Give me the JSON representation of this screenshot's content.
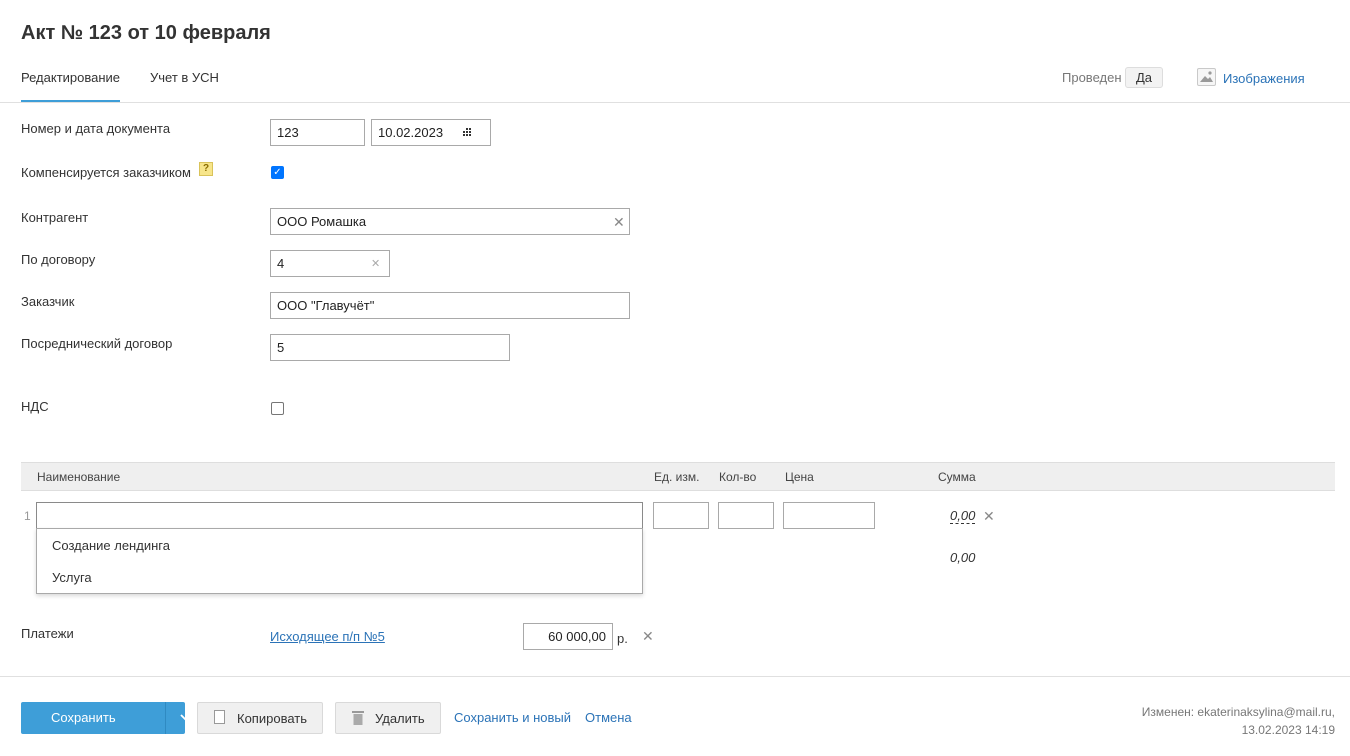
{
  "page_title": "Акт № 123 от 10 февраля",
  "tabs": [
    {
      "label": "Редактирование",
      "active": true
    },
    {
      "label": "Учет в УСН",
      "active": false
    }
  ],
  "status": {
    "posted_label": "Проведен",
    "posted_value": "Да"
  },
  "images_link": "Изображения",
  "form": {
    "doc_label": "Номер и дата документа",
    "doc_number": "123",
    "doc_date": "10.02.2023",
    "compensated_label": "Компенсируется заказчиком",
    "compensated_checked": true,
    "help_icon": "?",
    "contractor_label": "Контрагент",
    "contractor_value": "ООО Ромашка",
    "contract_label": "По договору",
    "contract_value": "4",
    "customer_label": "Заказчик",
    "customer_value": "ООО \"Главучёт\"",
    "agency_label": "Посреднический договор",
    "agency_value": "5",
    "vat_label": "НДС",
    "vat_checked": false
  },
  "table": {
    "headers": {
      "name": "Наименование",
      "unit": "Ед. изм.",
      "qty": "Кол-во",
      "price": "Цена",
      "sum": "Сумма"
    },
    "rows": [
      {
        "num": "1",
        "name": "",
        "unit": "",
        "qty": "",
        "price": "",
        "sum": "0,00"
      }
    ],
    "total": "0,00",
    "suggestions": [
      "Создание лендинга",
      "Услуга"
    ]
  },
  "payments": {
    "label": "Платежи",
    "link": "Исходящее п/п №5",
    "amount": "60 000,00",
    "currency": "р."
  },
  "footer": {
    "save": "Сохранить",
    "copy": "Копировать",
    "delete": "Удалить",
    "save_new": "Сохранить и новый",
    "cancel": "Отмена",
    "modified_line1": "Изменен: ekaterinaksylina@mail.ru,",
    "modified_line2": "13.02.2023 14:19"
  },
  "icons": {
    "clear": "✕",
    "calendar": "calendar-icon",
    "chevron": "chevron-down-icon",
    "image": "image-icon",
    "copy": "copy-icon",
    "trash": "trash-icon"
  },
  "colors": {
    "accent": "#3e9ed8",
    "link": "#2b73b7"
  }
}
